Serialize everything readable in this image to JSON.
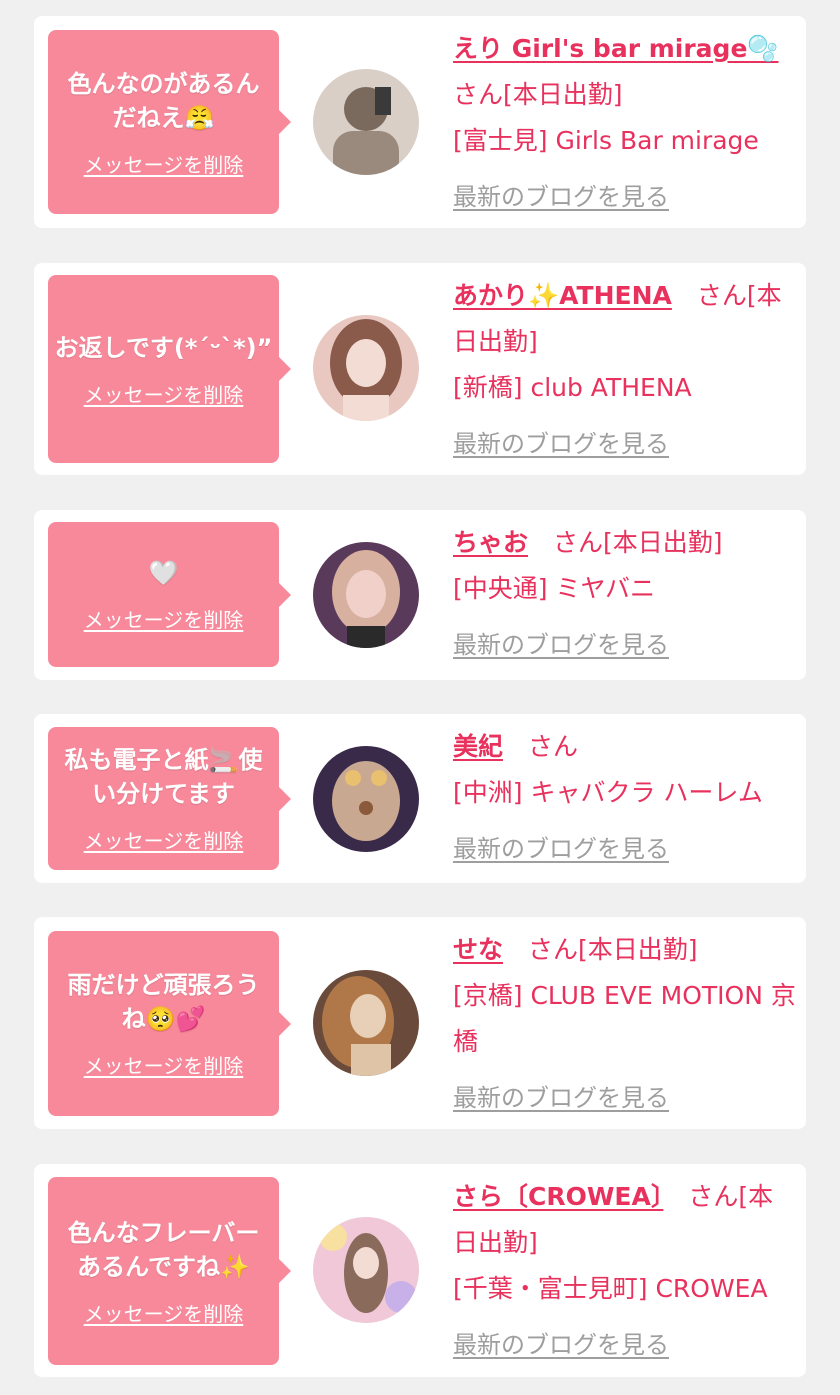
{
  "cards": [
    {
      "message": "色んなのがあるんだねえ😤",
      "delete_label": "メッセージを削除",
      "name": "えり Girl's bar mirage🫧",
      "suffix": "さん[本日出勤]",
      "shop": "[富士見] Girls Bar mirage",
      "blog": "最新のブログを見る",
      "avatar_colors": [
        "#d9cfc7",
        "#7a6a5e"
      ]
    },
    {
      "message": "お返しです(*ˊᵕˋ*)”",
      "delete_label": "メッセージを削除",
      "name": "あかり✨ATHENA",
      "suffix": "さん[本日出勤]",
      "shop": "[新橋] club ATHENA",
      "blog": "最新のブログを見る",
      "avatar_colors": [
        "#e8c8c0",
        "#8a5a4a"
      ]
    },
    {
      "message": "🤍",
      "delete_label": "メッセージを削除",
      "name": "ちゃお",
      "suffix": "さん[本日出勤]",
      "shop": "[中央通] ミヤバニ",
      "blog": "最新のブログを見る",
      "avatar_colors": [
        "#5a3a5a",
        "#f0d0c8"
      ]
    },
    {
      "message": "私も電子と紙🚬使い分けてます",
      "delete_label": "メッセージを削除",
      "name": "美紀",
      "suffix": "さん",
      "shop": "[中洲] キャバクラ ハーレム",
      "blog": "最新のブログを見る",
      "avatar_colors": [
        "#3a2a4a",
        "#c8a890"
      ]
    },
    {
      "message": "雨だけど頑張ろうね🥺💕",
      "delete_label": "メッセージを削除",
      "name": "せな",
      "suffix": "さん[本日出勤]",
      "shop": "[京橋] CLUB EVE MOTION 京橋",
      "blog": "最新のブログを見る",
      "avatar_colors": [
        "#6a4a3a",
        "#e8d0b8"
      ]
    },
    {
      "message": "色んなフレーバーあるんですね✨",
      "delete_label": "メッセージを削除",
      "name": "さら〔CROWEA〕",
      "suffix": "さん[本日出勤]",
      "shop": "[千葉・富士見町] CROWEA",
      "blog": "最新のブログを見る",
      "avatar_colors": [
        "#f0c8d8",
        "#b89aa8"
      ]
    }
  ]
}
